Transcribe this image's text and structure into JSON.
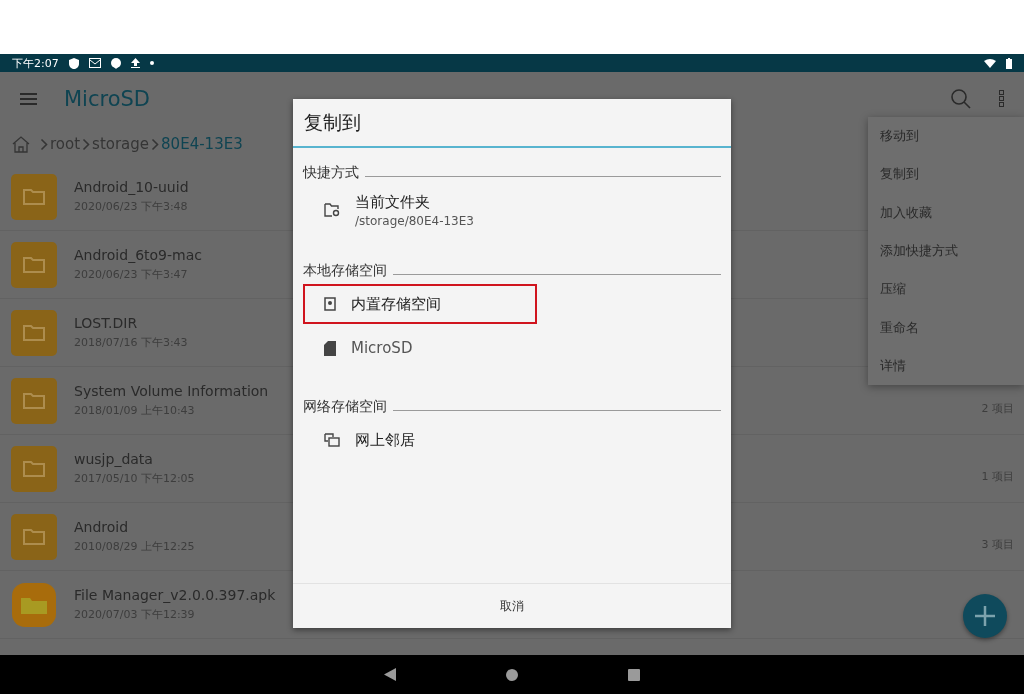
{
  "status_bar": {
    "time": "下午2:07"
  },
  "app_bar": {
    "title": "MicroSD"
  },
  "breadcrumb": [
    {
      "label": "root",
      "selected": false
    },
    {
      "label": "storage",
      "selected": false
    },
    {
      "label": "80E4-13E3",
      "selected": true
    }
  ],
  "files": [
    {
      "kind": "folder",
      "name": "Android_10-uuid",
      "date": "2020/06/23 下午3:48"
    },
    {
      "kind": "folder",
      "name": "Android_6to9-mac",
      "date": "2020/06/23 下午3:47"
    },
    {
      "kind": "folder",
      "name": "LOST.DIR",
      "date": "2018/07/16 下午3:43"
    },
    {
      "kind": "folder",
      "name": "System Volume Information",
      "date": "2018/01/09 上午10:43",
      "count": "2 项目"
    },
    {
      "kind": "folder",
      "name": "wusjp_data",
      "date": "2017/05/10 下午12:05",
      "count": "1 项目"
    },
    {
      "kind": "folder",
      "name": "Android",
      "date": "2010/08/29 上午12:25",
      "count": "3 项目"
    },
    {
      "kind": "apk",
      "name": "File Manager_v2.0.0.397.apk",
      "date": "2020/07/03 下午12:39"
    }
  ],
  "menu": [
    "移动到",
    "复制到",
    "加入收藏",
    "添加快捷方式",
    "压缩",
    "重命名",
    "详情"
  ],
  "dialog": {
    "title": "复制到",
    "sections": [
      {
        "heading": "快捷方式",
        "items": [
          {
            "kind": "folder-shortcut",
            "label": "当前文件夹",
            "sublabel": "/storage/80E4-13E3",
            "disabled": false,
            "highlighted": false
          }
        ]
      },
      {
        "heading": "本地存储空间",
        "items": [
          {
            "kind": "internal",
            "label": "内置存储空间",
            "disabled": false,
            "highlighted": true
          },
          {
            "kind": "sdcard",
            "label": "MicroSD",
            "disabled": true,
            "highlighted": false
          }
        ]
      },
      {
        "heading": "网络存储空间",
        "items": [
          {
            "kind": "network",
            "label": "网上邻居",
            "disabled": false,
            "highlighted": false
          }
        ]
      }
    ],
    "cancel": "取消"
  }
}
